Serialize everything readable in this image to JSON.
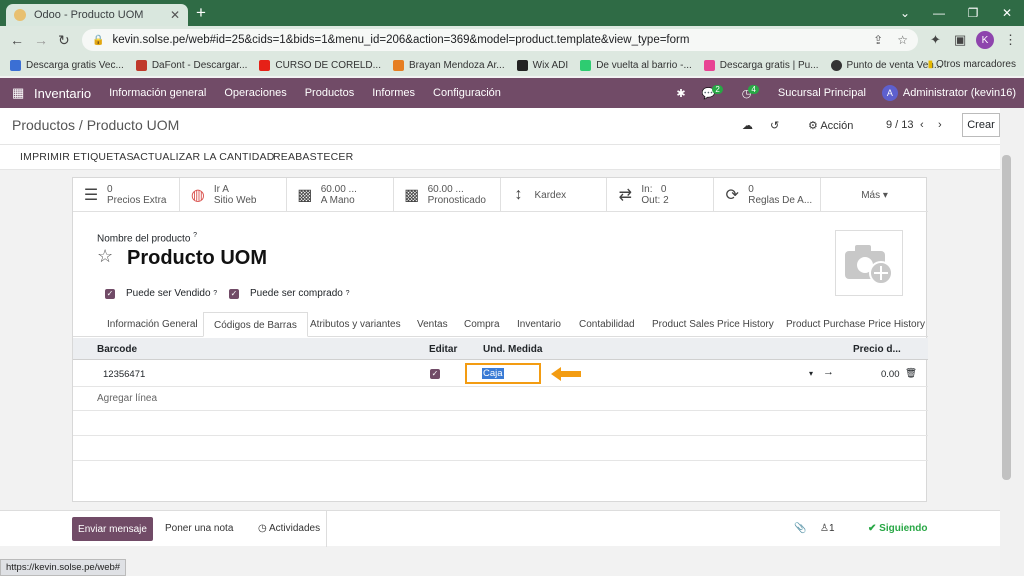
{
  "browser": {
    "tab_title": "Odoo - Producto UOM",
    "url": "kevin.solse.pe/web#id=25&cids=1&bids=1&menu_id=206&action=369&model=product.template&view_type=form",
    "profile_initial": "K",
    "bookmarks": [
      "Descarga gratis Vec...",
      "DaFont - Descargar...",
      "CURSO DE CORELD...",
      "Brayan Mendoza Ar...",
      "Wix ADI",
      "De vuelta al barrio -...",
      "Descarga gratis | Pu...",
      "Punto de venta Ven..."
    ],
    "other_bookmarks": "Otros marcadores",
    "status_url": "https://kevin.solse.pe/web#"
  },
  "navbar": {
    "app": "Inventario",
    "menus": [
      "Información general",
      "Operaciones",
      "Productos",
      "Informes",
      "Configuración"
    ],
    "chat_count": "2",
    "activity_count": "4",
    "company": "Sucursal Principal",
    "user_initial": "A",
    "user": "Administrator (kevin16)"
  },
  "control": {
    "breadcrumb": "Productos / Producto UOM",
    "action": "Acción",
    "pager": "9 / 13",
    "create": "Crear"
  },
  "statusbar": [
    "IMPRIMIR ETIQUETAS",
    "ACTUALIZAR LA CANTIDAD",
    "REABASTECER"
  ],
  "smart_buttons": [
    {
      "l1": "0",
      "l2": "Precios Extra"
    },
    {
      "l1": "Ir A",
      "l2": "Sitio Web"
    },
    {
      "l1": "60.00 ...",
      "l2": "A Mano"
    },
    {
      "l1": "60.00 ...",
      "l2": "Pronosticado"
    },
    {
      "l1": "Kardex",
      "l2": ""
    },
    {
      "l1": "In:",
      "v1": "0",
      "l2": "Out:",
      "v2": "2"
    },
    {
      "l1": "0",
      "l2": "Reglas De A..."
    },
    {
      "l1": "Más ▾"
    }
  ],
  "product": {
    "name_label": "Nombre del producto",
    "name": "Producto UOM",
    "sold_label": "Puede ser Vendido",
    "purchased_label": "Puede ser comprado"
  },
  "tabs": [
    "Información General",
    "Códigos de Barras",
    "Atributos y variantes",
    "Ventas",
    "Compra",
    "Inventario",
    "Contabilidad",
    "Product Sales Price History",
    "Product Purchase Price History"
  ],
  "table": {
    "headers": [
      "Barcode",
      "Editar",
      "Und. Medida",
      "Precio d..."
    ],
    "row": {
      "barcode": "12356471",
      "uom": "Caja",
      "price": "0.00"
    },
    "add_line": "Agregar línea"
  },
  "chatter": {
    "send": "Enviar mensaje",
    "note": "Poner una nota",
    "activities": "Actividades",
    "followers": "1",
    "following": "Siguiendo"
  },
  "colors": {
    "odoo_primary": "#714b67",
    "highlight": "#f39c12",
    "chrome": "#2f6b45"
  }
}
